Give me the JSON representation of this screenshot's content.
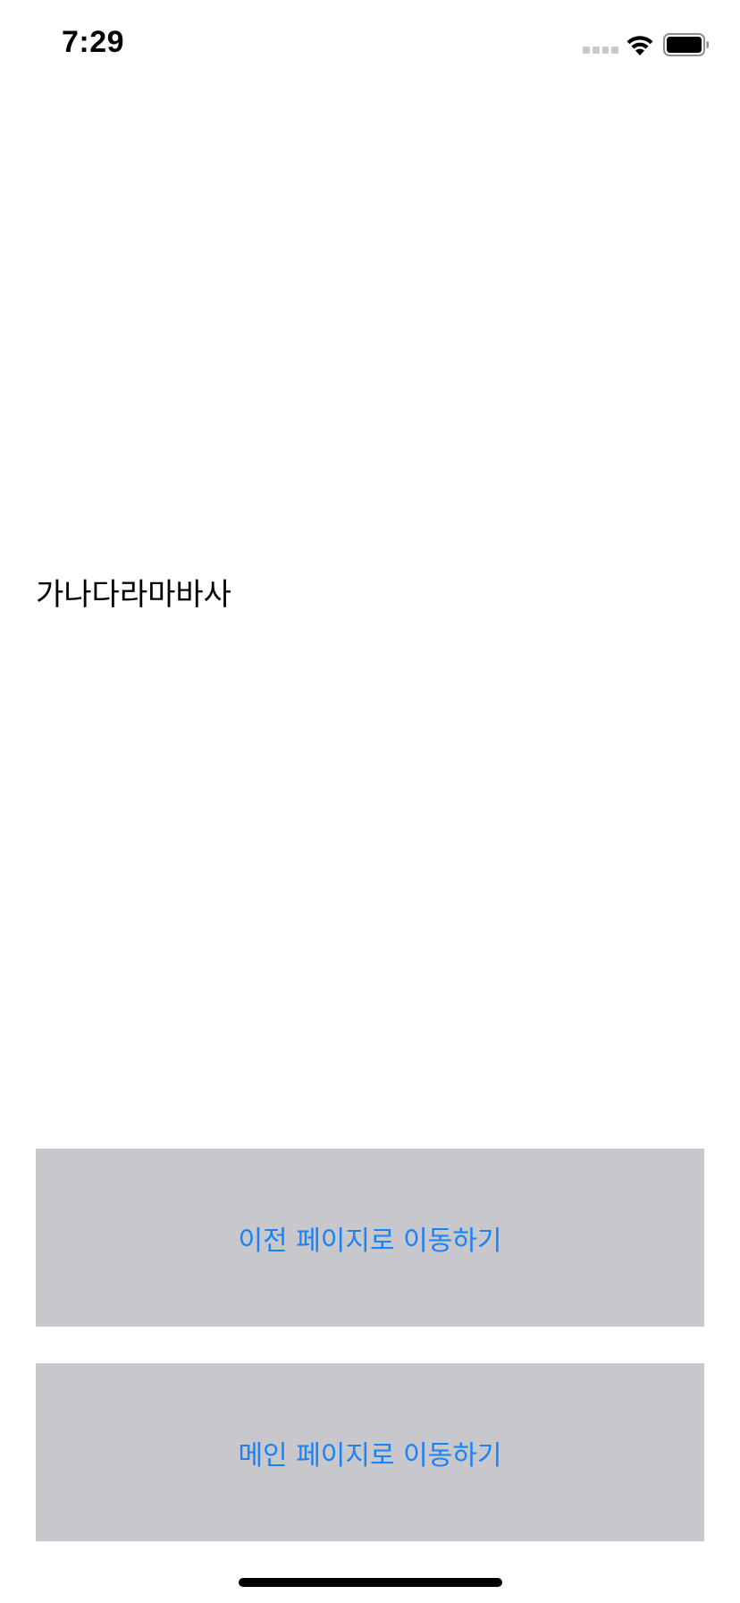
{
  "status_bar": {
    "time": "7:29",
    "signal_icon": "cellular-signal-empty-icon",
    "wifi_icon": "wifi-icon",
    "battery_icon": "battery-full-icon"
  },
  "main": {
    "label": "가나다라마바사"
  },
  "buttons": {
    "previous_page": "이전 페이지로 이동하기",
    "main_page": "메인 페이지로 이동하기"
  },
  "colors": {
    "button_background": "#c7c7cc",
    "button_text": "#1a82f5",
    "background": "#ffffff"
  }
}
